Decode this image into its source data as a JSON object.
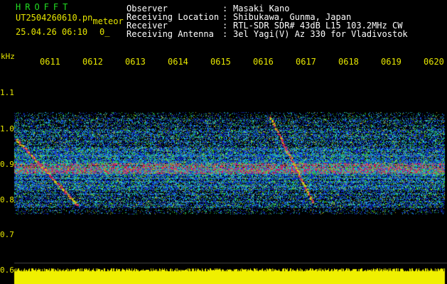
{
  "header": {
    "title": "HROFFT",
    "filename": "UT2504260610.pn",
    "filename_tag": "meteor",
    "datetime": "25.04.26 06:10",
    "extra": "0_"
  },
  "info": [
    {
      "label": "Observer",
      "sep": ":",
      "value": "Masaki Kano"
    },
    {
      "label": "Receiving Location",
      "sep": ":",
      "value": "Shibukawa, Gunma, Japan"
    },
    {
      "label": "Receiver",
      "sep": ":",
      "value": "RTL-SDR SDR# 43dB L15 103.2MHz CW"
    },
    {
      "label": "Receiving Antenna",
      "sep": ":",
      "value": "3el Yagi(V) Az 330 for Vladivostok"
    }
  ],
  "axis": {
    "unit": "kHz",
    "x_ticks": [
      "0611",
      "0612",
      "0613",
      "0614",
      "0615",
      "0616",
      "0617",
      "0618",
      "0619",
      "0620"
    ],
    "y_ticks": [
      "1.1",
      "1.0",
      "0.9",
      "0.8",
      "0.7",
      "0.6"
    ]
  },
  "colors": {
    "background": "#000000",
    "label_yellow": "#e6e600",
    "title_green": "#22dd22",
    "noise_blue": "#1030d0",
    "noise_cyan": "#20c0d8",
    "noise_green": "#30d030",
    "signal_red": "#e02060",
    "signal_yellow": "#e6e600",
    "level_yellow": "#f0f000"
  }
}
